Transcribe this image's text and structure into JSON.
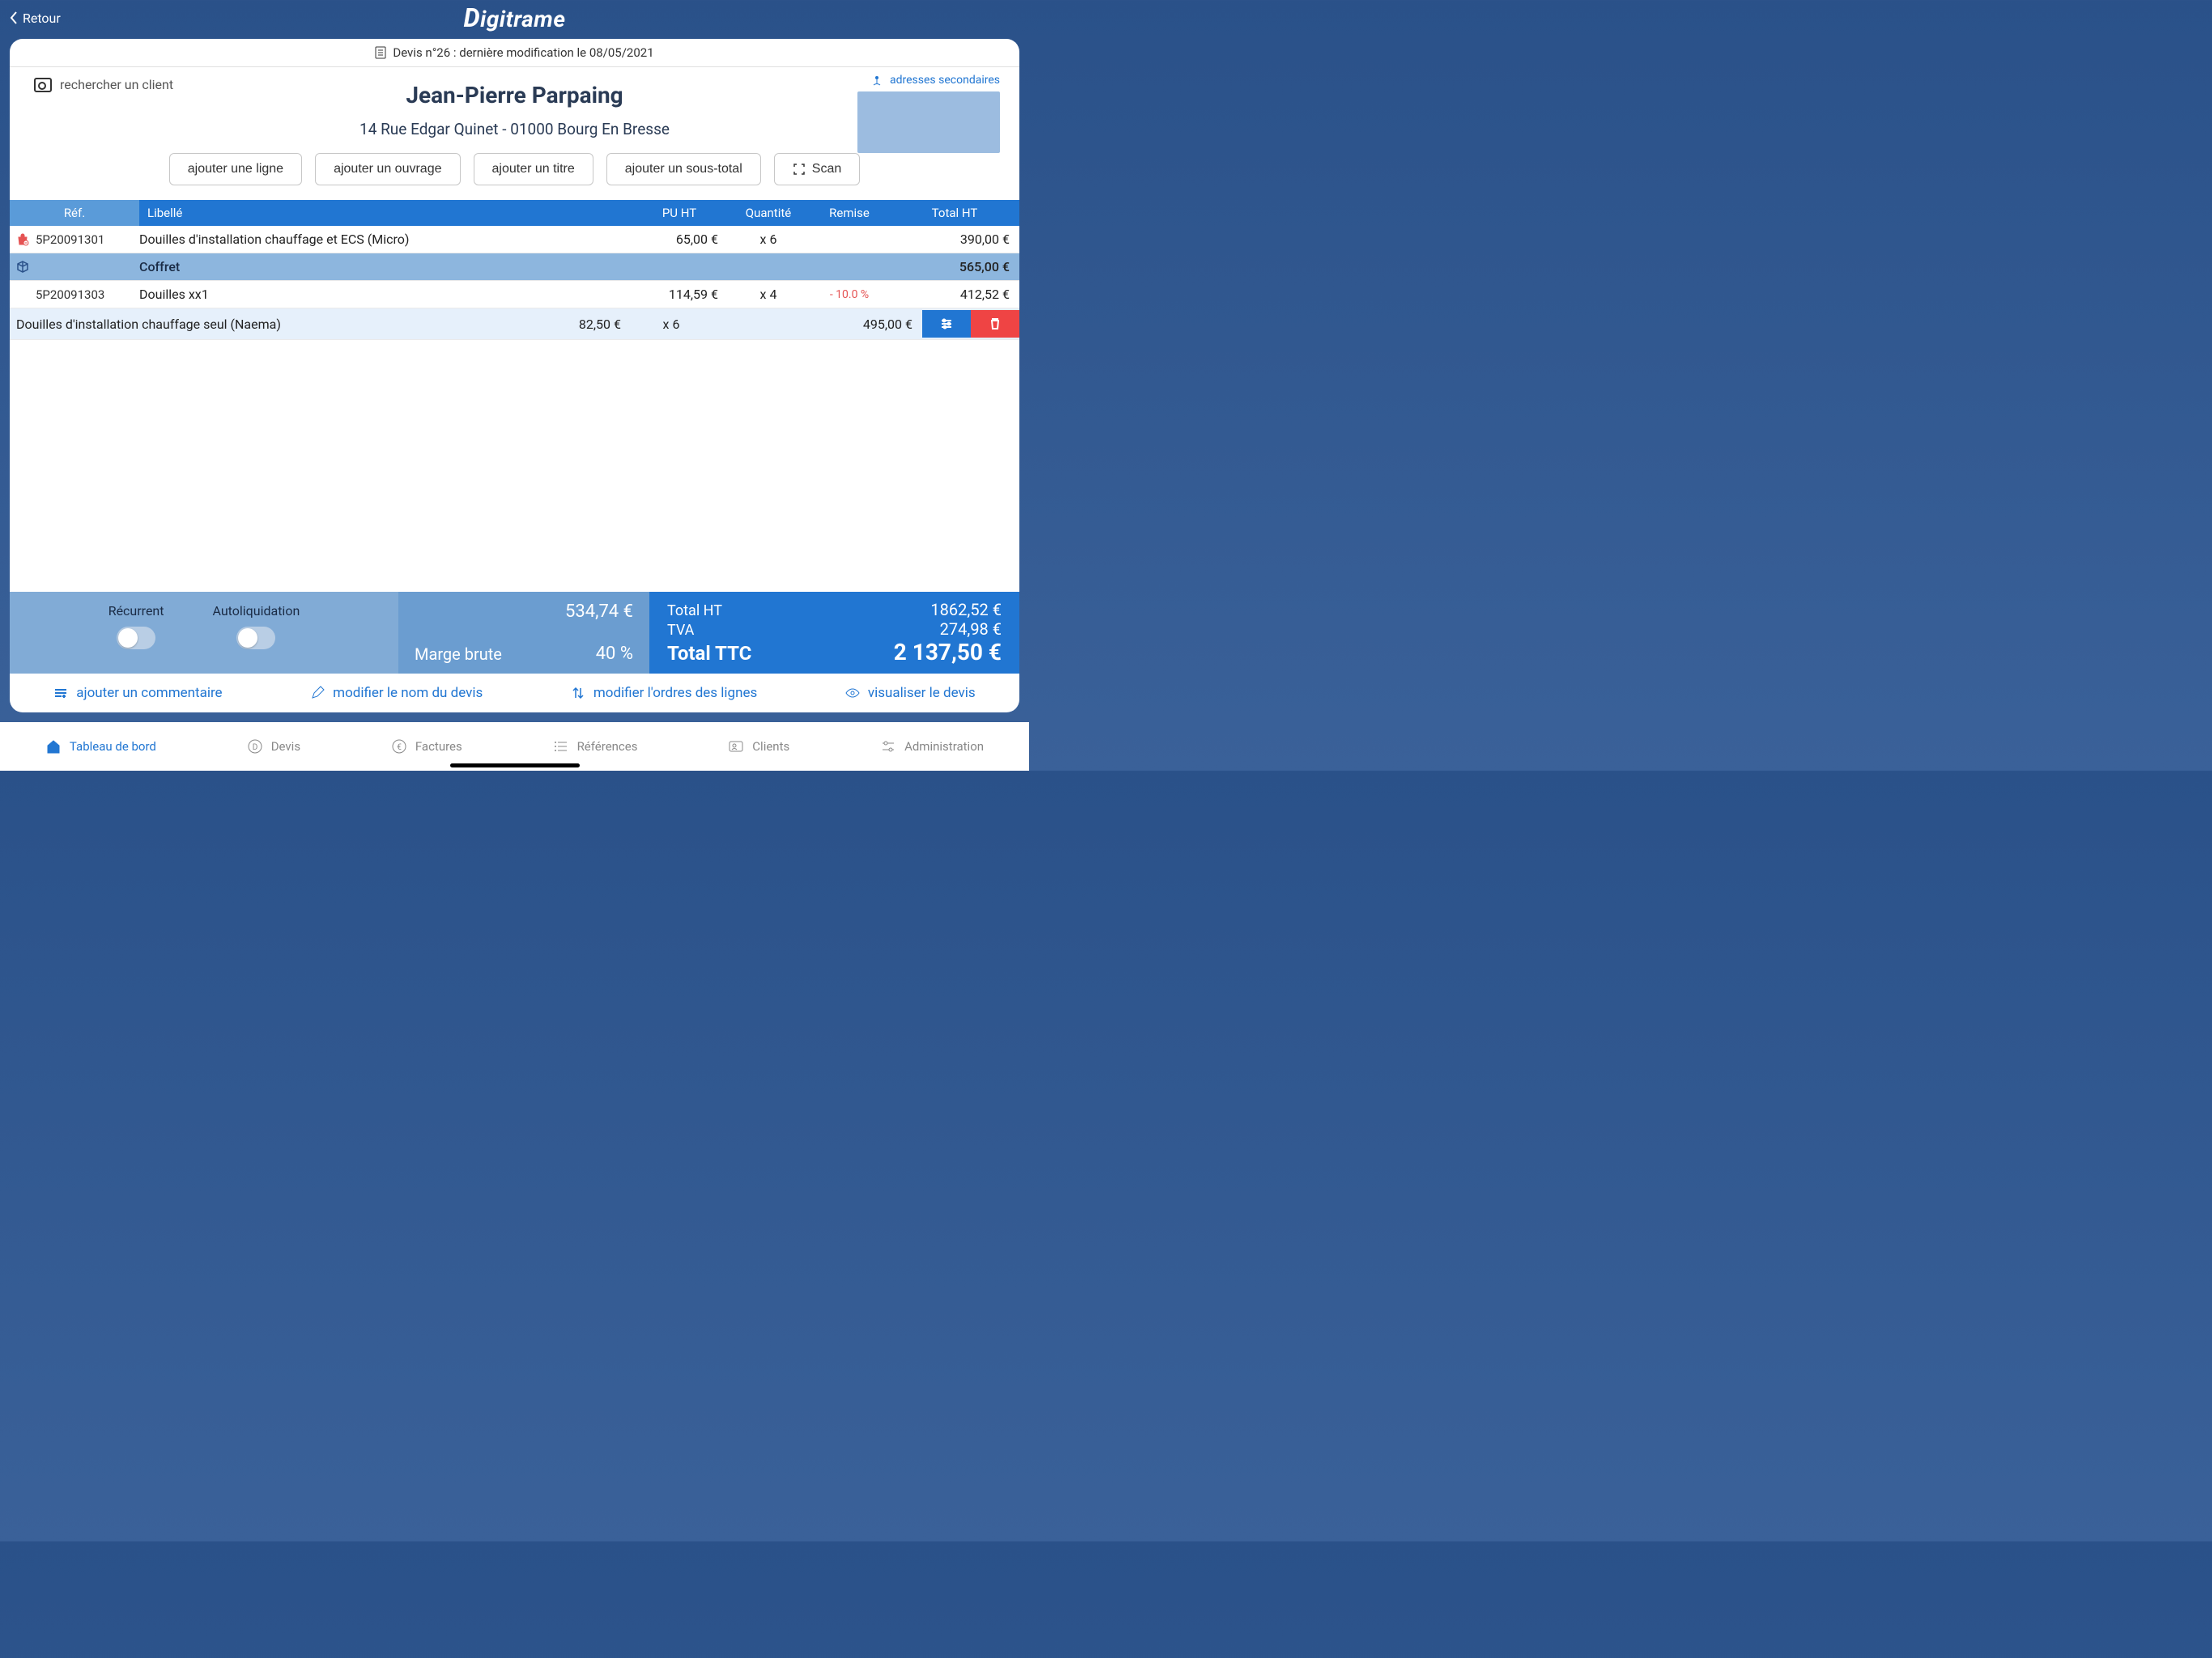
{
  "back_label": "Retour",
  "brand": "Digitrame",
  "doc_title": "Devis n°26 : dernière modification le 08/05/2021",
  "client": {
    "search_label": "rechercher un client",
    "sec_addr_label": "adresses secondaires",
    "name": "Jean-Pierre Parpaing",
    "address": "14 Rue Edgar Quinet - 01000 Bourg En Bresse"
  },
  "add_buttons": {
    "line": "ajouter une ligne",
    "work": "ajouter un ouvrage",
    "title": "ajouter un titre",
    "subtotal": "ajouter un sous-total",
    "scan": "Scan"
  },
  "table": {
    "headers": {
      "ref": "Réf.",
      "label": "Libellé",
      "pu": "PU HT",
      "qty": "Quantité",
      "discount": "Remise",
      "total": "Total HT"
    },
    "rows": [
      {
        "type": "line",
        "icon": "bag",
        "ref": "5P20091301",
        "label": "Douilles d'installation chauffage et ECS (Micro)",
        "pu": "65,00 €",
        "qty": "x 6",
        "discount": "",
        "total": "390,00 €"
      },
      {
        "type": "group",
        "icon": "cube",
        "ref": "",
        "label": "Coffret",
        "pu": "",
        "qty": "",
        "discount": "",
        "total": "565,00 €"
      },
      {
        "type": "line",
        "icon": "",
        "ref": "5P20091303",
        "label": "Douilles  xx1",
        "pu": "114,59 €",
        "qty": "x 4",
        "discount": "- 10.0 %",
        "total": "412,52 €"
      },
      {
        "type": "selected",
        "icon": "",
        "ref": "",
        "label": "Douilles d'installation chauffage seul (Naema)",
        "pu": "82,50 €",
        "qty": "x 6",
        "discount": "",
        "total": "495,00 €"
      }
    ]
  },
  "options": {
    "recurrent": "Récurrent",
    "autoliq": "Autoliquidation"
  },
  "margin": {
    "amount": "534,74 €",
    "label": "Marge brute",
    "pct": "40 %"
  },
  "totals": {
    "ht_label": "Total HT",
    "ht": "1862,52 €",
    "tva_label": "TVA",
    "tva": "274,98 €",
    "ttc_label": "Total TTC",
    "ttc": "2 137,50 €"
  },
  "links": {
    "comment": "ajouter un commentaire",
    "rename": "modifier le nom du devis",
    "reorder": "modifier l'ordres des lignes",
    "view": "visualiser le devis"
  },
  "nav": {
    "dashboard": "Tableau de bord",
    "quotes": "Devis",
    "invoices": "Factures",
    "refs": "Références",
    "clients": "Clients",
    "admin": "Administration"
  }
}
